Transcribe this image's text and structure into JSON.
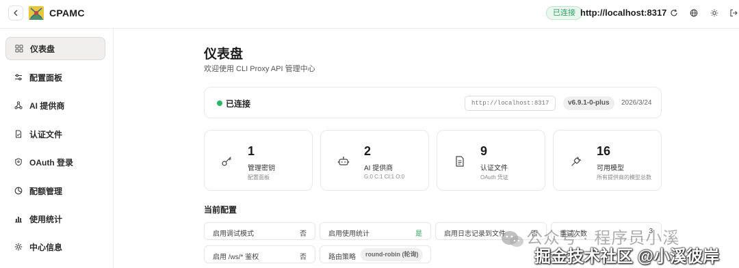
{
  "header": {
    "app_title": "CPAMC",
    "connection_badge": "已连接",
    "server_url": "http://localhost:8317",
    "icons": [
      "chevron-left-icon",
      "refresh-icon",
      "globe-icon",
      "sun-icon",
      "logout-icon"
    ]
  },
  "sidebar": {
    "items": [
      {
        "label": "仪表盘",
        "icon": "dashboard-icon",
        "active": true
      },
      {
        "label": "配置面板",
        "icon": "sliders-icon",
        "active": false
      },
      {
        "label": "AI 提供商",
        "icon": "nodes-icon",
        "active": false
      },
      {
        "label": "认证文件",
        "icon": "file-icon",
        "active": false
      },
      {
        "label": "OAuth 登录",
        "icon": "shield-icon",
        "active": false
      },
      {
        "label": "配额管理",
        "icon": "pie-icon",
        "active": false
      },
      {
        "label": "使用统计",
        "icon": "bar-chart-icon",
        "active": false
      },
      {
        "label": "中心信息",
        "icon": "gear-icon",
        "active": false
      }
    ]
  },
  "main": {
    "title": "仪表盘",
    "subtitle": "欢迎使用 CLI Proxy API 管理中心",
    "status": {
      "text": "已连接",
      "url": "http://localhost:8317",
      "version": "v6.9.1-0-plus",
      "date": "2026/3/24",
      "dot_color": "#2bb56b"
    },
    "stats": [
      {
        "value": "1",
        "label": "管理密钥",
        "sub": "配置面板",
        "icon": "key-icon"
      },
      {
        "value": "2",
        "label": "AI 提供商",
        "sub": "G:0 C:1 Cl:1 O:0",
        "icon": "robot-icon"
      },
      {
        "value": "9",
        "label": "认证文件",
        "sub": "OAuth 凭证",
        "icon": "document-icon"
      },
      {
        "value": "16",
        "label": "可用模型",
        "sub": "所有提供商的模型总数",
        "icon": "plug-icon"
      }
    ],
    "config_title": "当前配置",
    "config_items": [
      {
        "label": "启用调试模式",
        "value": "否"
      },
      {
        "label": "启用使用统计",
        "value": "是"
      },
      {
        "label": "启用日志记录到文件",
        "value": "否"
      },
      {
        "label": "重试次数",
        "value": "3"
      },
      {
        "label": "启用 /ws/* 鉴权",
        "value": "否"
      },
      {
        "label": "路由策略",
        "value": "round-robin (轮询)"
      }
    ]
  },
  "watermark": {
    "line1": "公众号 · 程序员小溪",
    "line2": "掘金技术社区 @小溪彼岸"
  },
  "colors": {
    "accent_green": "#2f9e60",
    "border": "#e8e8e8",
    "active_nav_bg": "#f0efed"
  }
}
